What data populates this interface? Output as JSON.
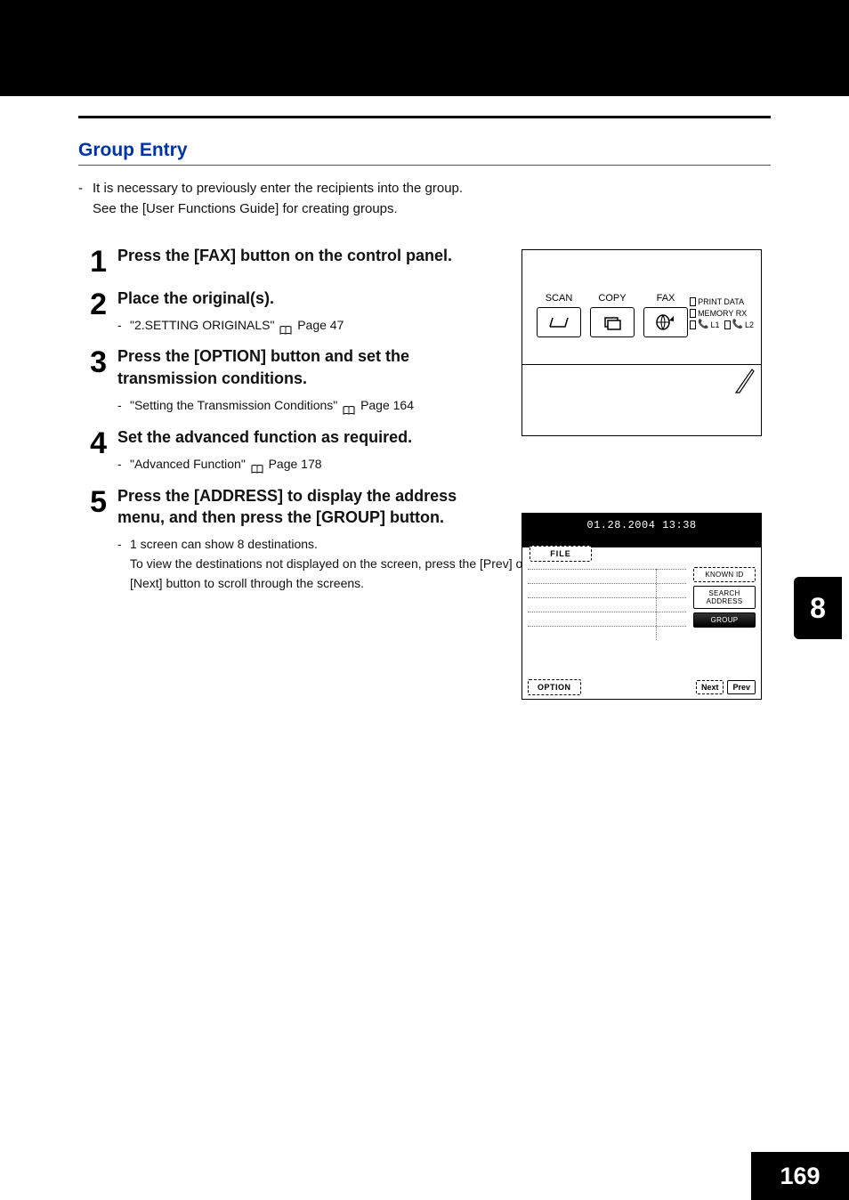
{
  "section_title": "Group Entry",
  "intro": {
    "line1": "It is necessary to previously enter the recipients into the group.",
    "line2": "See the [User Functions Guide] for creating groups."
  },
  "steps": [
    {
      "num": "1",
      "heading": "Press the [FAX] button on the control panel."
    },
    {
      "num": "2",
      "heading": "Place the original(s).",
      "sub_prefix": "\"2.SETTING ORIGINALS\"",
      "sub_page": "Page 47"
    },
    {
      "num": "3",
      "heading": "Press the [OPTION] button and set the transmission conditions.",
      "sub_prefix": "\"Setting the Transmission Conditions\"",
      "sub_page": "Page 164"
    },
    {
      "num": "4",
      "heading": "Set the advanced function as required.",
      "sub_prefix": "\"Advanced Function\"",
      "sub_page": "Page 178"
    },
    {
      "num": "5",
      "heading": "Press the [ADDRESS] to display the address menu, and then press the [GROUP] button.",
      "sub_text": "1 screen can show 8 destinations.\nTo view the destinations not displayed on the screen, press the [Prev] or [Next] button to scroll through the screens."
    }
  ],
  "fig1": {
    "labels": {
      "scan": "SCAN",
      "copy": "COPY",
      "fax": "FAX"
    },
    "status": {
      "print_data": "PRINT DATA",
      "memory_rx": "MEMORY RX",
      "l1": "L1",
      "l2": "L2"
    }
  },
  "fig2": {
    "timestamp": "01.28.2004 13:38",
    "file_tab": "FILE",
    "side_buttons": {
      "known_id": "KNOWN ID",
      "search_address": "SEARCH ADDRESS",
      "group": "GROUP"
    },
    "option": "OPTION",
    "next": "Next",
    "prev": "Prev"
  },
  "chapter_tab": "8",
  "page_number": "169"
}
